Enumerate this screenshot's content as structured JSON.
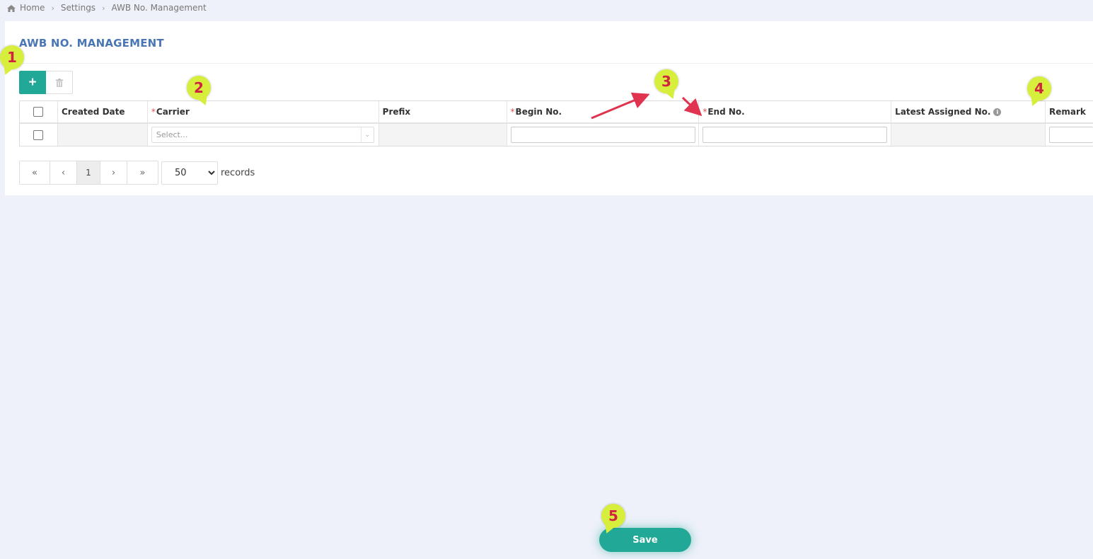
{
  "breadcrumb": {
    "items": [
      "Home",
      "Settings",
      "AWB No. Management"
    ]
  },
  "page": {
    "title": "AWB NO. MANAGEMENT"
  },
  "toolbar": {
    "add_label": "+",
    "add_icon": "plus-icon",
    "delete_icon": "trash-icon"
  },
  "table": {
    "columns": [
      {
        "label": "",
        "required": false
      },
      {
        "label": "Created Date",
        "required": false
      },
      {
        "label": "Carrier",
        "required": true
      },
      {
        "label": "Prefix",
        "required": false
      },
      {
        "label": "Begin No.",
        "required": true
      },
      {
        "label": "End No.",
        "required": true
      },
      {
        "label": "Latest Assigned No.",
        "required": false,
        "info_icon": true
      },
      {
        "label": "Remark",
        "required": false
      }
    ],
    "required_marker": "*",
    "info_icon_glyph": "i",
    "new_row": {
      "carrier_placeholder": "Select...",
      "begin_no": "",
      "end_no": "",
      "remark": ""
    }
  },
  "pager": {
    "first": "«",
    "prev": "‹",
    "current_page": "1",
    "next": "›",
    "last": "»",
    "page_size": "50",
    "page_size_options": [
      "50"
    ],
    "records_label": "records"
  },
  "footer": {
    "save_label": "Save"
  },
  "annotations": {
    "callouts": [
      "1",
      "2",
      "3",
      "4",
      "5"
    ]
  },
  "colors": {
    "accent": "#22a896",
    "title": "#4a76b5",
    "required": "#d9534f",
    "callout_bg": "#d8ee3c",
    "callout_text": "#d0233f",
    "arrow": "#e03350"
  }
}
